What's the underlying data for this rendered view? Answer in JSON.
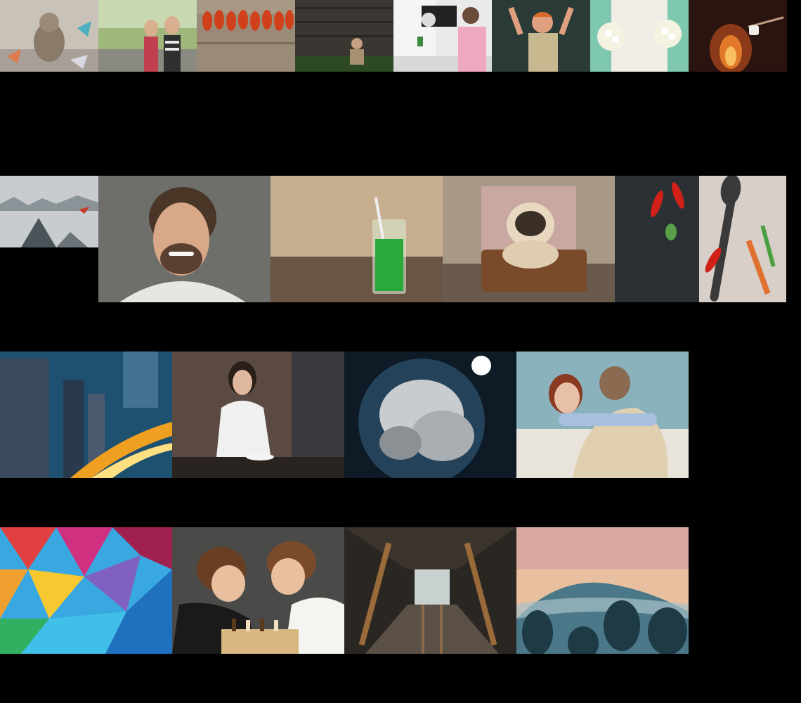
{
  "gallery": {
    "background": "#000000",
    "photos": [
      {
        "name": "kitten-with-paper-cranes"
      },
      {
        "name": "two-women-hitchhiking"
      },
      {
        "name": "shrimp-on-wooden-table"
      },
      {
        "name": "child-sitting-by-wooden-wall"
      },
      {
        "name": "man-working-at-desk"
      },
      {
        "name": "cheering-boy-at-chalkboard"
      },
      {
        "name": "bride-with-bouquet"
      },
      {
        "name": "marshmallow-over-fire"
      },
      {
        "name": "plane-over-misty-mountains"
      },
      {
        "name": "smiling-bearded-man"
      },
      {
        "name": "green-smoothie-glass"
      },
      {
        "name": "pug-in-suitcase"
      },
      {
        "name": "chili-peppers-and-spoon"
      },
      {
        "name": "city-night-light-trails"
      },
      {
        "name": "woman-on-phone-in-cafe"
      },
      {
        "name": "earth-with-clouds"
      },
      {
        "name": "couple-hugging"
      },
      {
        "name": "colorful-polygon-abstract"
      },
      {
        "name": "boys-playing-chess"
      },
      {
        "name": "wooden-tunnel-passage"
      },
      {
        "name": "misty-forest-mountain"
      }
    ]
  }
}
